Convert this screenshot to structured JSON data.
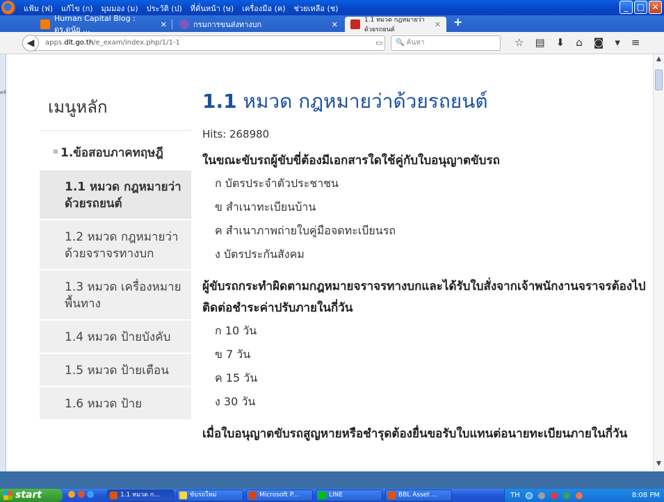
{
  "menu": [
    "แฟ้ม (ฟ)",
    "แก้ไข (ก)",
    "มุมมอง (ม)",
    "ประวัติ (ป)",
    "ที่คั่นหน้า (ษ)",
    "เครื่องมือ (ค)",
    "ช่วยเหลือ (ช)"
  ],
  "tabs": [
    {
      "label": "Human Capital Blog : ดร.ดนัย ...",
      "color": "#f57c00"
    },
    {
      "label": "กรมการขนส่งทางบก",
      "color": "#7e57c2"
    },
    {
      "label": "1.1 หมวด กฎหมายว่าด้วยรถยนต์",
      "color": "#c62828"
    }
  ],
  "nav": {
    "url_prefix": "apps.",
    "url_domain": "dlt.go.th",
    "url_path": "/e_exam/index.php/1/1-1",
    "search_placeholder": "ค้นหา"
  },
  "leftstrip_text": "คลิ",
  "sidebar": {
    "title": "เมนูหลัก",
    "main_item": "1.ข้อสอบภาคทฤษฎี",
    "items": [
      "1.1 หมวด กฎหมายว่าด้วยรถยนต์",
      "1.2 หมวด กฎหมายว่าด้วยจราจรทางบก",
      "1.3 หมวด เครื่องหมายพื้นทาง",
      "1.4 หมวด ป้ายบังคับ",
      "1.5 หมวด ป้ายเตือน",
      "1.6 หมวด ป้าย"
    ]
  },
  "content": {
    "heading_num": "1.1",
    "heading_text": "หมวด กฎหมายว่าด้วยรถยนต์",
    "hits": "Hits: 268980",
    "questions": [
      {
        "q": "ในขณะขับรถผู้ขับขี่ต้องมีเอกสารใดใช้คู่กับใบอนุญาตขับรถ",
        "options": [
          "ก บัตรประจำตัวประชาชน",
          "ข สำเนาทะเบียนบ้าน",
          "ค สำเนาภาพถ่ายใบคู่มือจดทะเบียนรถ",
          "ง บัตรประกันสังคม"
        ]
      },
      {
        "q": "ผู้ขับรถกระทำผิดตามกฎหมายจราจรทางบกและได้รับใบสั่งจากเจ้าพนักงานจราจรต้องไปติดต่อชำระค่าปรับภายในกี่วัน",
        "options": [
          "ก 10 วัน",
          "ข 7 วัน",
          "ค 15 วัน",
          "ง 30 วัน"
        ]
      },
      {
        "q": "เมื่อใบอนุญาตขับรถสูญหายหรือชำรุดต้องยื่นขอรับใบแทนต่อนายทะเบียนภายในกี่วัน",
        "options": []
      }
    ]
  },
  "taskbar": {
    "start": "start",
    "buttons": [
      {
        "label": "1.1 หมวด ก...",
        "color": "#e65100",
        "active": true
      },
      {
        "label": "ขับรถใหม่",
        "color": "#fdd835",
        "active": false
      },
      {
        "label": "Microsoft P...",
        "color": "#d84315",
        "active": false
      },
      {
        "label": "LINE",
        "color": "#00c300",
        "active": false
      },
      {
        "label": "BBL Asset ...",
        "color": "#e65100",
        "active": false
      }
    ],
    "lang": "TH",
    "clock": "8:08 PM"
  }
}
